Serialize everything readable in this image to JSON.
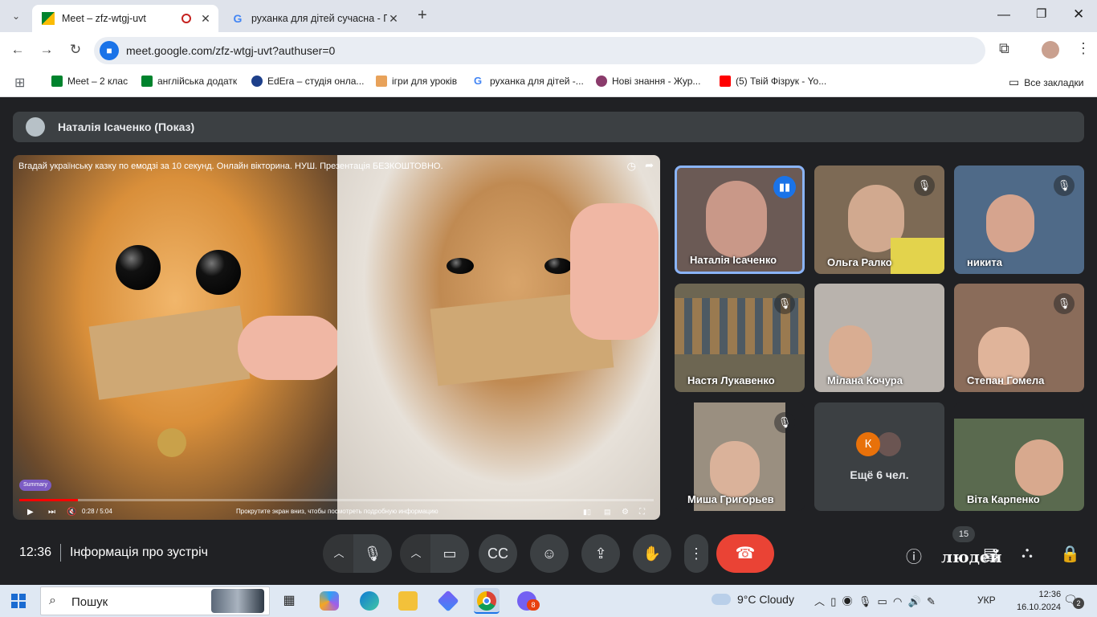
{
  "browser": {
    "tabs": [
      {
        "title": "Meet – zfz-wtgj-uvt",
        "active": true
      },
      {
        "title": "руханка для дітей сучасна - По",
        "active": false
      }
    ],
    "new_tab": "+",
    "window_controls": [
      "minimize",
      "restore",
      "close"
    ],
    "url": "meet.google.com/zfz-wtgj-uvt?authuser=0",
    "bookmarks": [
      "Meet – 2 клас",
      "англійська додатк",
      "EdEra – студія онла...",
      "ігри для уроків",
      "руханка для дітей -...",
      "Нові знання - Жур...",
      "(5) Твій Фізрук - Yo..."
    ],
    "all_bookmarks": "Все закладки"
  },
  "meet": {
    "presenter": "Наталія Ісаченко (Показ)",
    "video": {
      "title": "Вгадай українську казку по емодзі за 10 секунд. Онлайн вікторина. НУШ. Презентація БЕЗКОШТОВНО.",
      "badge": "Summary",
      "time": "0:28 / 5:04",
      "hint": "Прокрутите экран вниз, чтобы посмотреть подробную информацию",
      "progress": 0.093
    },
    "participants": [
      {
        "name": "Наталія Ісаченко",
        "speaking": true,
        "muted": false,
        "bg": "#6b5a55"
      },
      {
        "name": "Ольга Ралко",
        "speaking": false,
        "muted": true,
        "bg": "#7d6a55"
      },
      {
        "name": "никита",
        "speaking": false,
        "muted": true,
        "bg": "#4f6a88"
      },
      {
        "name": "Настя Лукавенко",
        "speaking": false,
        "muted": true,
        "bg": "#6d6652"
      },
      {
        "name": "Мілана Кочура",
        "speaking": false,
        "muted": false,
        "bg": "#b9b3ad"
      },
      {
        "name": "Степан Гомела",
        "speaking": false,
        "muted": true,
        "bg": "#8a6c5a"
      },
      {
        "name": "Миша Григорьев",
        "speaking": false,
        "muted": true,
        "bg": "#9a8f80"
      },
      {
        "name": "Віта Карпенко",
        "speaking": false,
        "muted": false,
        "bg": "#5a6a4f"
      }
    ],
    "more_tile": {
      "initial": "К",
      "label": "Ещё 6 чел."
    },
    "clock": "12:36",
    "meeting_info": "Інформація про зустріч",
    "people_count": "15",
    "people_label": "людей"
  },
  "taskbar": {
    "search": "Пошук",
    "weather": "9°C  Cloudy",
    "lang": "УКР",
    "time": "12:36",
    "date": "16.10.2024",
    "notifications": "2",
    "badge": "8"
  }
}
